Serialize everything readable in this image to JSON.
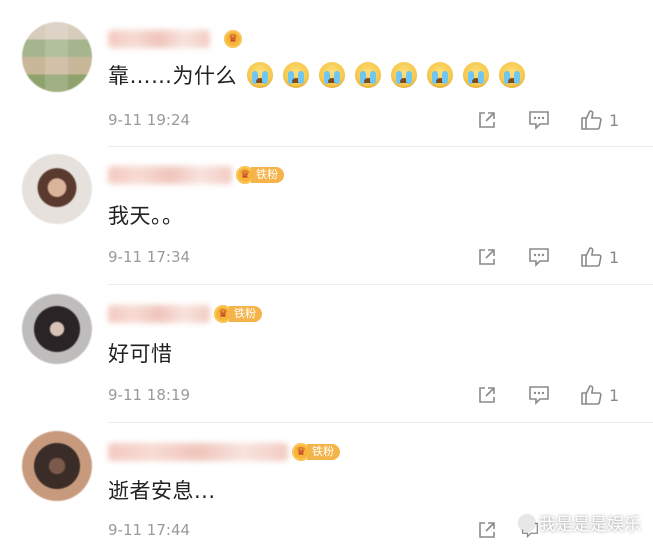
{
  "comments": [
    {
      "text": "靠……为什么",
      "emoji_count": 8,
      "emoji_icon": "crying-face-icon",
      "time": "9-11 19:24",
      "likes": "1",
      "fan_label": ""
    },
    {
      "text": "我天。。",
      "time": "9-11 17:34",
      "likes": "1",
      "fan_label": "铁粉"
    },
    {
      "text": "好可惜",
      "time": "9-11 18:19",
      "likes": "1",
      "fan_label": "铁粉"
    },
    {
      "text": "逝者安息...",
      "time": "9-11 17:44",
      "likes": "",
      "fan_label": "铁粉"
    }
  ],
  "icons": {
    "crown": "crown-badge-icon",
    "share": "share-icon",
    "reply": "comment-icon",
    "like": "thumbs-up-icon"
  },
  "colors": {
    "badge": "#f4b449",
    "meta_text": "#9a9a9a"
  },
  "watermark": {
    "text": "我是是是娱乐"
  }
}
